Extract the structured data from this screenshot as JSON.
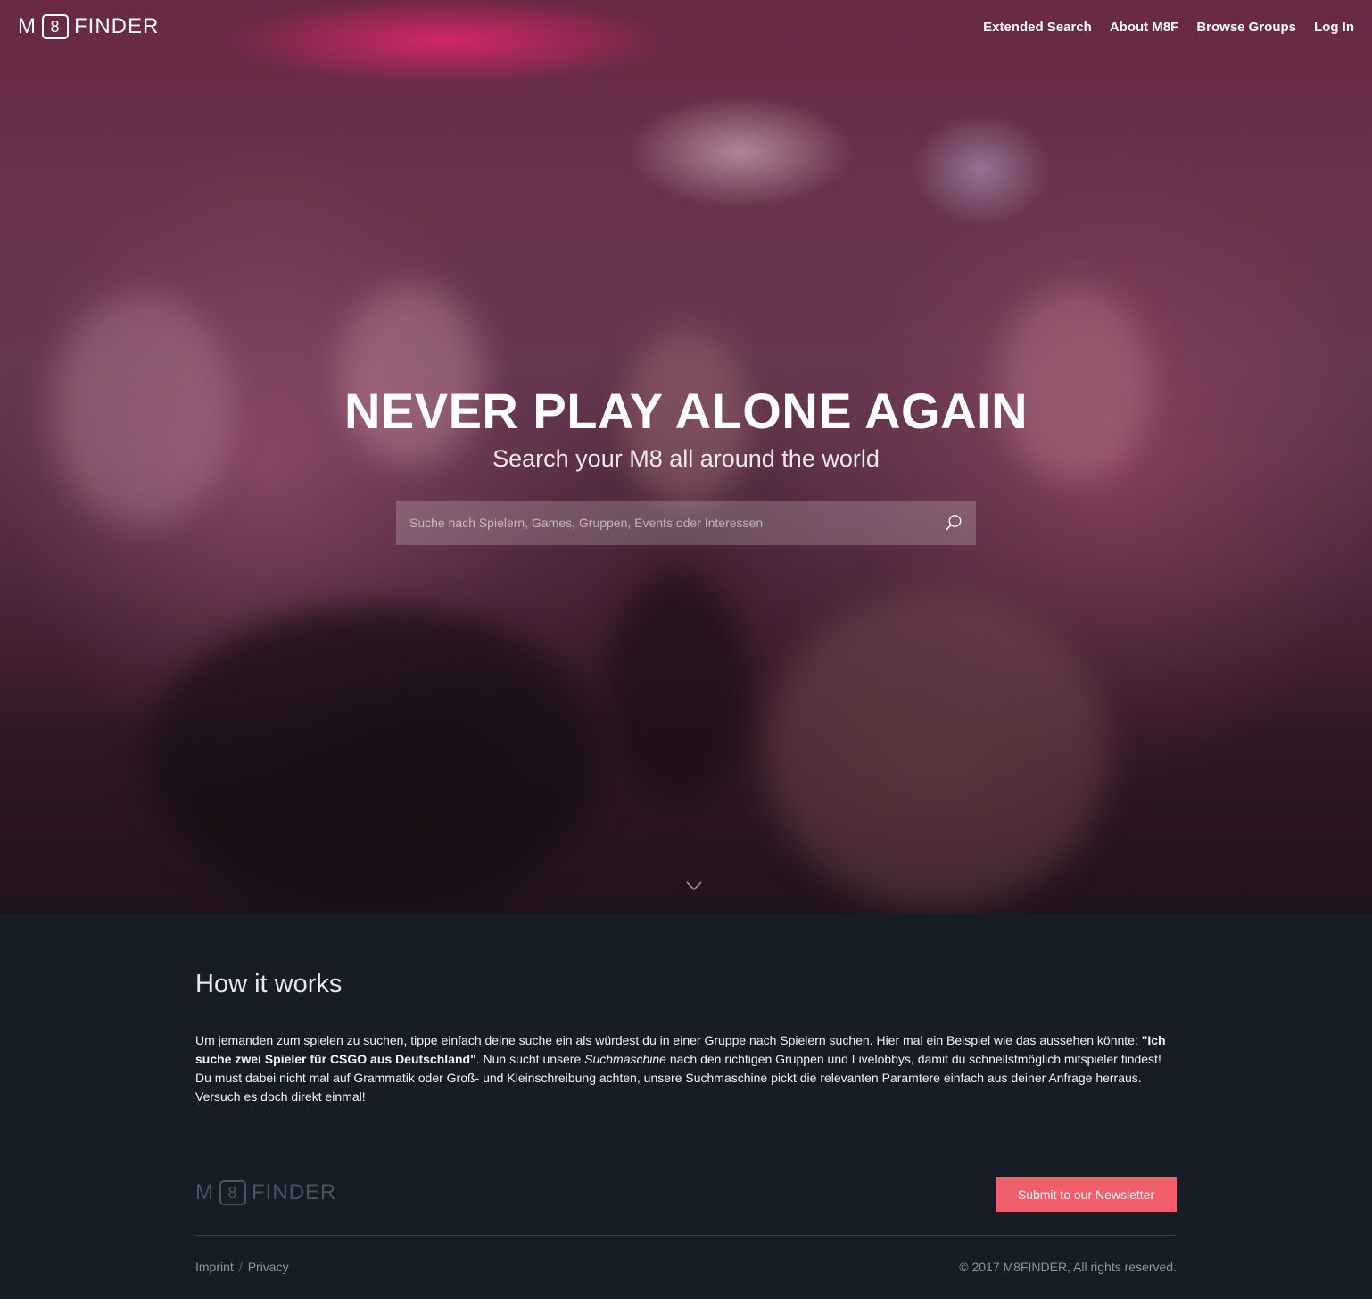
{
  "header": {
    "logo": {
      "left": "M",
      "box": "8",
      "right": "FINDER"
    },
    "nav": [
      {
        "label": "Extended Search"
      },
      {
        "label": "About M8F"
      },
      {
        "label": "Browse Groups"
      },
      {
        "label": "Log In"
      }
    ]
  },
  "hero": {
    "title": "NEVER PLAY ALONE AGAIN",
    "subtitle": "Search your M8 all around the world",
    "search": {
      "placeholder": "Suche nach Spielern, Games, Gruppen, Events oder Interessen",
      "value": "",
      "icon": "search-icon"
    },
    "scroll_icon": "chevron-down-icon"
  },
  "how_it_works": {
    "title": "How it works",
    "text_1": "Um jemanden zum spielen zu suchen, tippe einfach deine suche ein als würdest du in einer Gruppe nach Spielern suchen. Hier mal ein Beispiel wie das aussehen könnte: ",
    "example": "\"Ich suche zwei Spieler für CSGO aus Deutschland\"",
    "text_2": ". Nun sucht unsere ",
    "engine": "Suchmaschine",
    "text_3": " nach den richtigen Gruppen und Livelobbys, damit du schnellstmöglich mitspieler findest! Du must dabei nicht mal auf Grammatik oder Groß- und Kleinschreibung achten, unsere Suchmaschine pickt die relevanten Paramtere einfach aus deiner Anfrage herraus. Versuch es doch direkt einmal!"
  },
  "footer": {
    "logo": {
      "left": "M",
      "box": "8",
      "right": "FINDER"
    },
    "newsletter_label": "Submit to our Newsletter",
    "links": [
      {
        "label": "Imprint"
      },
      {
        "label": "Privacy"
      }
    ],
    "separator": "/",
    "copyright": "© 2017 M8FINDER, All rights reserved."
  },
  "colors": {
    "accent": "#f05d6b",
    "background": "#171d27"
  }
}
